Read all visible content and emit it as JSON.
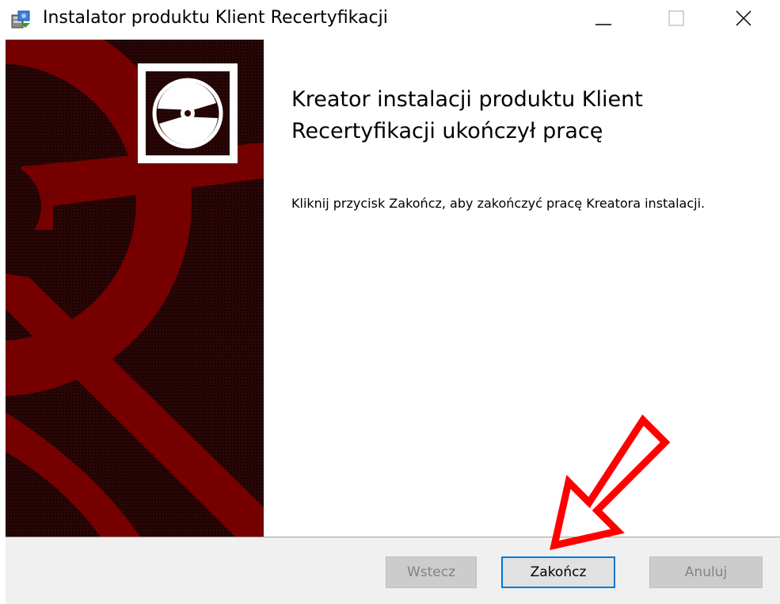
{
  "window": {
    "title": "Instalator produktu Klient Recertyfikacji",
    "app_icon": "installer-icon",
    "controls": {
      "minimize_icon": "minimize-icon",
      "maximize_icon": "maximize-icon",
      "close_icon": "close-icon"
    }
  },
  "banner": {
    "logo_icon": "disc-icon",
    "colors": {
      "background": "#2a0606",
      "shape": "#7a0000",
      "logo_frame": "#ffffff"
    }
  },
  "main": {
    "title": "Kreator instalacji produktu Klient Recertyfikacji ukończył pracę",
    "description": "Kliknij przycisk Zakończ, aby zakończyć pracę Kreatora instalacji."
  },
  "footer": {
    "back_label": "Wstecz",
    "finish_label": "Zakończ",
    "cancel_label": "Anuluj"
  },
  "annotation": {
    "icon": "red-arrow-icon",
    "color": "#ff0000"
  }
}
